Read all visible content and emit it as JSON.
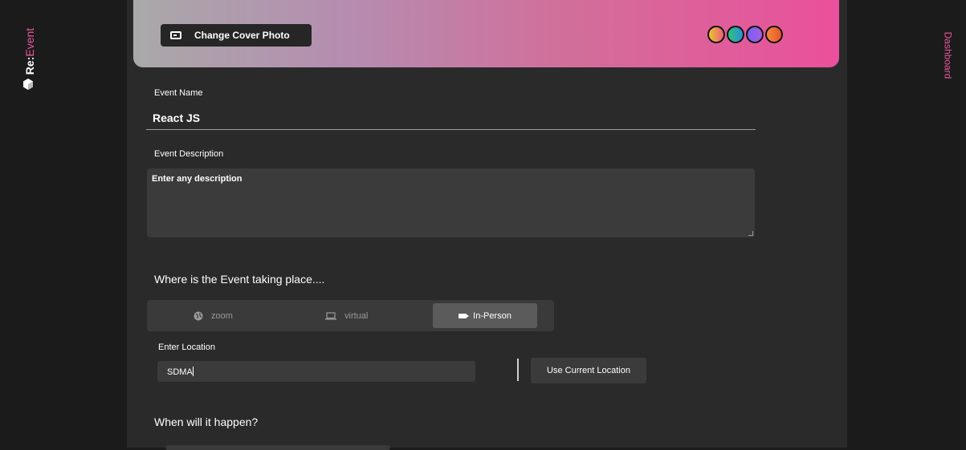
{
  "brand": {
    "prefix": "Re:",
    "suffix": "Event",
    "accent_color": "#e9589e",
    "logo_icon": "cube-icon"
  },
  "nav": {
    "dashboard_label": "Dashboard"
  },
  "cover": {
    "change_photo_label": "Change Cover Photo",
    "photo_icon": "image-icon",
    "gradient_colors": [
      "#a9a9a9",
      "#ea509b"
    ],
    "swatch_colors": [
      [
        "#f2c230",
        "#e85f7a"
      ],
      [
        "#2fc07a",
        "#2e8fd8"
      ],
      [
        "#7a5ef0",
        "#a45ee6"
      ],
      [
        "#f28a3a",
        "#e8542f"
      ]
    ]
  },
  "form": {
    "event_name_label": "Event Name",
    "event_name_value": "React JS",
    "event_description_label": "Event Description",
    "event_description_placeholder": "Enter any description",
    "where_heading": "Where is the Event taking place....",
    "location_types": [
      {
        "label": "zoom",
        "icon": "globe-icon",
        "selected": false
      },
      {
        "label": "virtual",
        "icon": "laptop-icon",
        "selected": false
      },
      {
        "label": "In-Person",
        "icon": "video-camera-icon",
        "selected": true
      }
    ],
    "enter_location_label": "Enter Location",
    "location_value": "SDMA",
    "use_current_location_label": "Use Current Location",
    "when_heading": "When will it happen?"
  }
}
